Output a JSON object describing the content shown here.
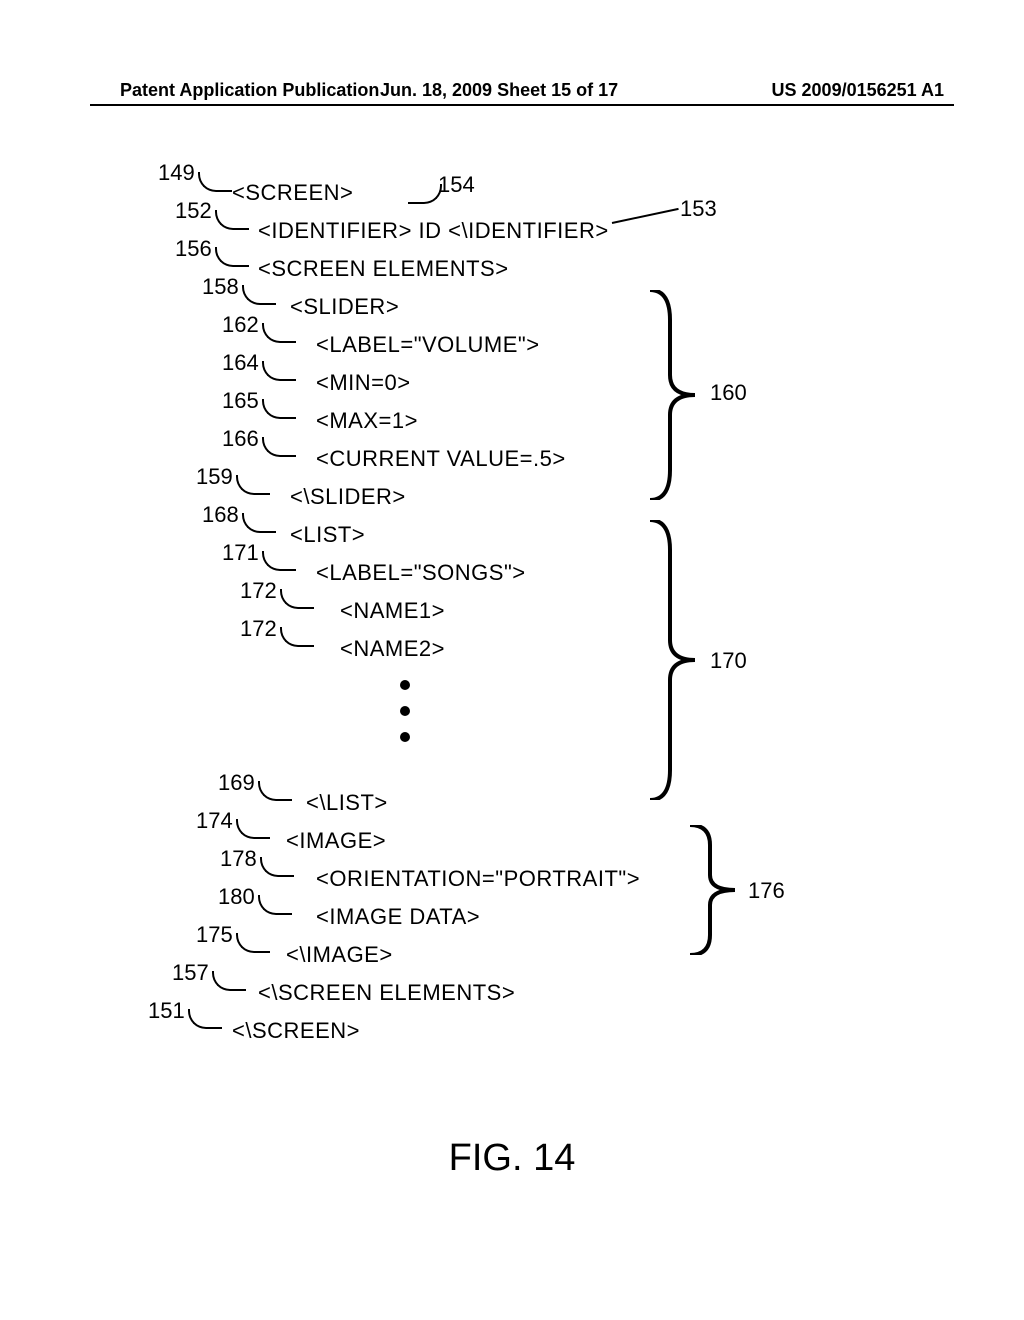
{
  "header": {
    "left": "Patent Application Publication",
    "mid": "Jun. 18, 2009  Sheet 15 of 17",
    "right": "US 2009/0156251 A1"
  },
  "figure_label": "FIG. 14",
  "lines": {
    "l149": "<SCREEN>",
    "l152": "<IDENTIFIER> ID <\\IDENTIFIER>",
    "l156": "<SCREEN ELEMENTS>",
    "l158": "<SLIDER>",
    "l162": "<LABEL=\"VOLUME\">",
    "l164": "<MIN=0>",
    "l165": "<MAX=1>",
    "l166": "<CURRENT VALUE=.5>",
    "l159": "<\\SLIDER>",
    "l168": "<LIST>",
    "l171": "<LABEL=\"SONGS\">",
    "l172a": "<NAME1>",
    "l172b": "<NAME2>",
    "l169": "<\\LIST>",
    "l174": "<IMAGE>",
    "l178": "<ORIENTATION=\"PORTRAIT\">",
    "l180": "<IMAGE DATA>",
    "l175": "<\\IMAGE>",
    "l157": "<\\SCREEN ELEMENTS>",
    "l151": "<\\SCREEN>"
  },
  "refs": {
    "r149": "149",
    "r152": "152",
    "r154": "154",
    "r153": "153",
    "r156": "156",
    "r158": "158",
    "r162": "162",
    "r164": "164",
    "r165": "165",
    "r166": "166",
    "r159": "159",
    "r168": "168",
    "r171": "171",
    "r172": "172",
    "r169": "169",
    "r174": "174",
    "r178": "178",
    "r180": "180",
    "r175": "175",
    "r157": "157",
    "r151": "151",
    "r160": "160",
    "r170": "170",
    "r176": "176"
  }
}
